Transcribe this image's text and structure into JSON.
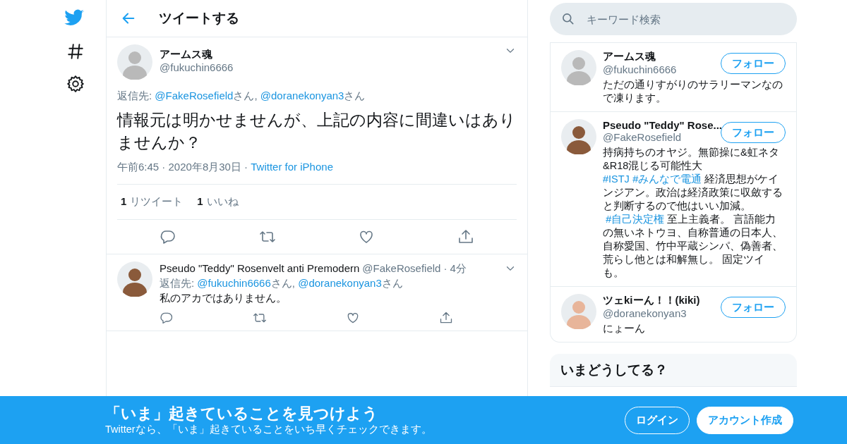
{
  "header": {
    "title": "ツイートする"
  },
  "main_tweet": {
    "name": "アームス魂",
    "handle": "@fukuchin6666",
    "reply_to": [
      {
        "kind": "text",
        "text": "返信先: "
      },
      {
        "kind": "mention",
        "text": "@FakeRosefield"
      },
      {
        "kind": "text",
        "text": "さん, "
      },
      {
        "kind": "mention",
        "text": "@doranekonyan3"
      },
      {
        "kind": "text",
        "text": "さん"
      }
    ],
    "text": "情報元は明かせませんが、上記の内容に間違いはありませんか？",
    "meta": [
      {
        "kind": "text",
        "text": "午前6:45 · 2020年8月30日 · "
      },
      {
        "kind": "link",
        "text": "Twitter for iPhone"
      }
    ],
    "stats": [
      {
        "count": "1",
        "label": "リツイート"
      },
      {
        "count": "1",
        "label": "いいね"
      }
    ]
  },
  "reply_tweet": {
    "name": "Pseudo \"Teddy\" Rosenvelt anti Premodern",
    "handle": "@FakeRosefield",
    "separator": "·",
    "time": "4分",
    "reply_to": [
      {
        "kind": "text",
        "text": "返信先: "
      },
      {
        "kind": "mention",
        "text": "@fukuchin6666"
      },
      {
        "kind": "text",
        "text": "さん, "
      },
      {
        "kind": "mention",
        "text": "@doranekonyan3"
      },
      {
        "kind": "text",
        "text": "さん"
      }
    ],
    "text": "私のアカではありません。"
  },
  "search": {
    "placeholder": "キーワード検索"
  },
  "users": [
    {
      "name": "アームス魂",
      "handle": "@fukuchin6666",
      "button": "フォロー",
      "bio": [
        {
          "kind": "text",
          "text": "ただの通りすがりのサラリーマンなので凍ります。"
        }
      ]
    },
    {
      "name": "Pseudo \"Teddy\" Rose...",
      "handle": "@FakeRosefield",
      "button": "フォロー",
      "bio": [
        {
          "kind": "text",
          "text": "持病持ちのオヤジ。無節操に&虹ネタ&R18混じる可能性大 "
        },
        {
          "kind": "hashtag",
          "text": "#ISTJ"
        },
        {
          "kind": "hashtag",
          "text": "#みんなで電通"
        },
        {
          "kind": "text",
          "text": " 経済思想がケインジアン。政治は経済政策に収斂すると判断するので他はいい加減。"
        },
        {
          "kind": "hashtag",
          "text": "#自己決定権"
        },
        {
          "kind": "text",
          "text": " 至上主義者。 言語能力の無いネトウヨ、自称普通の日本人、自称愛国、竹中平蔵シンパ、偽善者、荒らし他とは和解無し。 固定ツイも。"
        }
      ]
    },
    {
      "name": "ツェkiーん！！(kiki)",
      "handle": "@doranekonyan3",
      "button": "フォロー",
      "bio": [
        {
          "kind": "text",
          "text": "にょーん"
        }
      ]
    }
  ],
  "trends": {
    "title": "いまどうしてる？"
  },
  "banner": {
    "title": "「いま」起きていることを見つけよう",
    "subtitle": "Twitterなら、「いま」起きていることをいち早くチェックできます。",
    "buttons": [
      {
        "kind": "outline",
        "label": "ログイン"
      },
      {
        "kind": "filled",
        "label": "アカウント作成"
      }
    ]
  }
}
